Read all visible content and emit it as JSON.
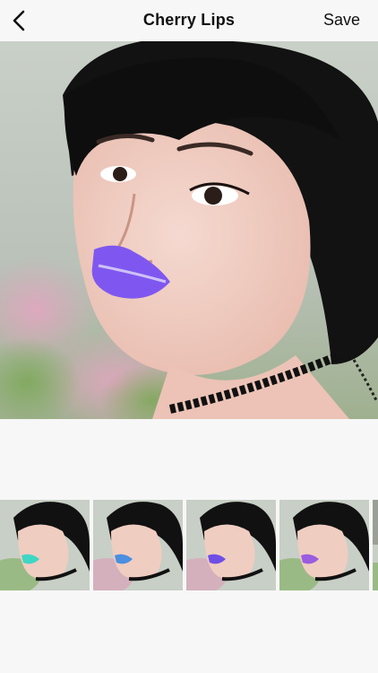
{
  "header": {
    "title": "Cherry Lips",
    "save_label": "Save",
    "back_icon": "chevron-left-icon"
  },
  "main_photo": {
    "lip_color": "#7f57f0"
  },
  "thumbnails": [
    {
      "lip_color": "#3fd6c4"
    },
    {
      "lip_color": "#4a8fe0"
    },
    {
      "lip_color": "#6f4fe6"
    },
    {
      "lip_color": "#9a5ce0"
    }
  ]
}
